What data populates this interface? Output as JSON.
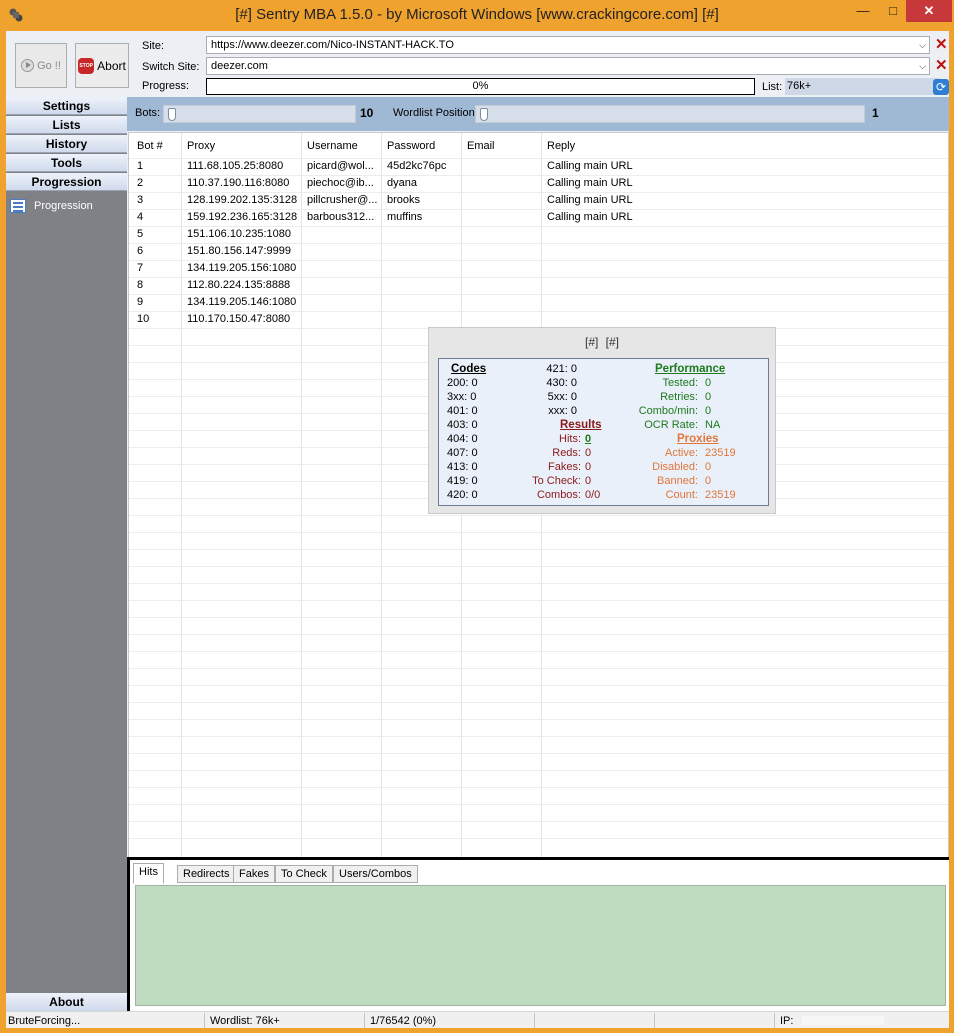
{
  "window": {
    "title": "[#] Sentry MBA 1.5.0 - by Microsoft Windows [www.crackingcore.com] [#]",
    "minimize": "—",
    "maximize": "□",
    "close": "✕"
  },
  "toolbar": {
    "go_label": "Go !!",
    "abort_label": "Abort",
    "abort_sign": "STOP",
    "site_label": "Site:",
    "site_value": "https://www.deezer.com/Nico-INSTANT-HACK.TO",
    "switch_label": "Switch Site:",
    "switch_value": "deezer.com",
    "progress_label": "Progress:",
    "progress_text": "0%",
    "progress_value": 0,
    "list_label": "List:",
    "list_value": "76k+",
    "dropdown_glyph": "⌵",
    "clear_glyph": "✕",
    "refresh_glyph": "⟳"
  },
  "sidebar": {
    "items": [
      {
        "label": "Settings"
      },
      {
        "label": "Lists"
      },
      {
        "label": "History"
      },
      {
        "label": "Tools"
      },
      {
        "label": "Progression"
      }
    ],
    "sub_item": "Progression",
    "about": "About"
  },
  "controls": {
    "bots_label": "Bots:",
    "bots_value": "10",
    "wordlist_label": "Wordlist Position:",
    "wordlist_value": "1"
  },
  "table": {
    "columns": [
      "Bot #",
      "Proxy",
      "Username",
      "Password",
      "Email",
      "Reply"
    ],
    "rows": [
      [
        "1",
        "111.68.105.25:8080",
        "picard@wol...",
        "45d2kc76pc",
        "",
        "Calling main URL"
      ],
      [
        "2",
        "110.37.190.116:8080",
        "piechoc@ib...",
        "dyana",
        "",
        "Calling main URL"
      ],
      [
        "3",
        "128.199.202.135:3128",
        "pillcrusher@...",
        "brooks",
        "",
        "Calling main URL"
      ],
      [
        "4",
        "159.192.236.165:3128",
        "barbous312...",
        "muffins",
        "",
        "Calling main URL"
      ],
      [
        "5",
        "151.106.10.235:1080",
        "",
        "",
        "",
        ""
      ],
      [
        "6",
        "151.80.156.147:9999",
        "",
        "",
        "",
        ""
      ],
      [
        "7",
        "134.119.205.156:1080",
        "",
        "",
        "",
        ""
      ],
      [
        "8",
        "112.80.224.135:8888",
        "",
        "",
        "",
        ""
      ],
      [
        "9",
        "134.119.205.146:1080",
        "",
        "",
        "",
        ""
      ],
      [
        "10",
        "110.170.150.47:8080",
        "",
        "",
        "",
        ""
      ]
    ]
  },
  "stats": {
    "header": "[#] [#]",
    "codes_title": "Codes",
    "codes_a": [
      "200: 0",
      "3xx: 0",
      "401: 0",
      "403: 0",
      "404: 0",
      "407: 0",
      "413: 0",
      "419: 0",
      "420: 0"
    ],
    "codes_b": [
      "421: 0",
      "430: 0",
      "5xx: 0",
      "xxx: 0"
    ],
    "results_title": "Results",
    "results": [
      {
        "label": "Hits:",
        "value": "0"
      },
      {
        "label": "Reds:",
        "value": "0"
      },
      {
        "label": "Fakes:",
        "value": "0"
      },
      {
        "label": "To Check:",
        "value": "0"
      },
      {
        "label": "Combos:",
        "value": "0/0"
      }
    ],
    "performance_title": "Performance",
    "performance": [
      {
        "label": "Tested:",
        "value": "0"
      },
      {
        "label": "Retries:",
        "value": "0"
      },
      {
        "label": "Combo/min:",
        "value": "0"
      },
      {
        "label": "OCR Rate:",
        "value": "NA"
      }
    ],
    "proxies_title": "Proxies",
    "proxies": [
      {
        "label": "Active:",
        "value": "23519"
      },
      {
        "label": "Disabled:",
        "value": "0"
      },
      {
        "label": "Banned:",
        "value": "0"
      },
      {
        "label": "Count:",
        "value": "23519"
      }
    ],
    "colors": {
      "codes": "#000000",
      "results": "#8b1a1a",
      "performance": "#1e7a1e",
      "proxies": "#e0763a"
    }
  },
  "tabs": [
    "Hits",
    "Redirects",
    "Fakes",
    "To Check",
    "Users/Combos"
  ],
  "status": {
    "state": "BruteForcing...",
    "wordlist": "Wordlist: 76k+",
    "position": "1/76542 (0%)",
    "ip_label": "IP:"
  }
}
